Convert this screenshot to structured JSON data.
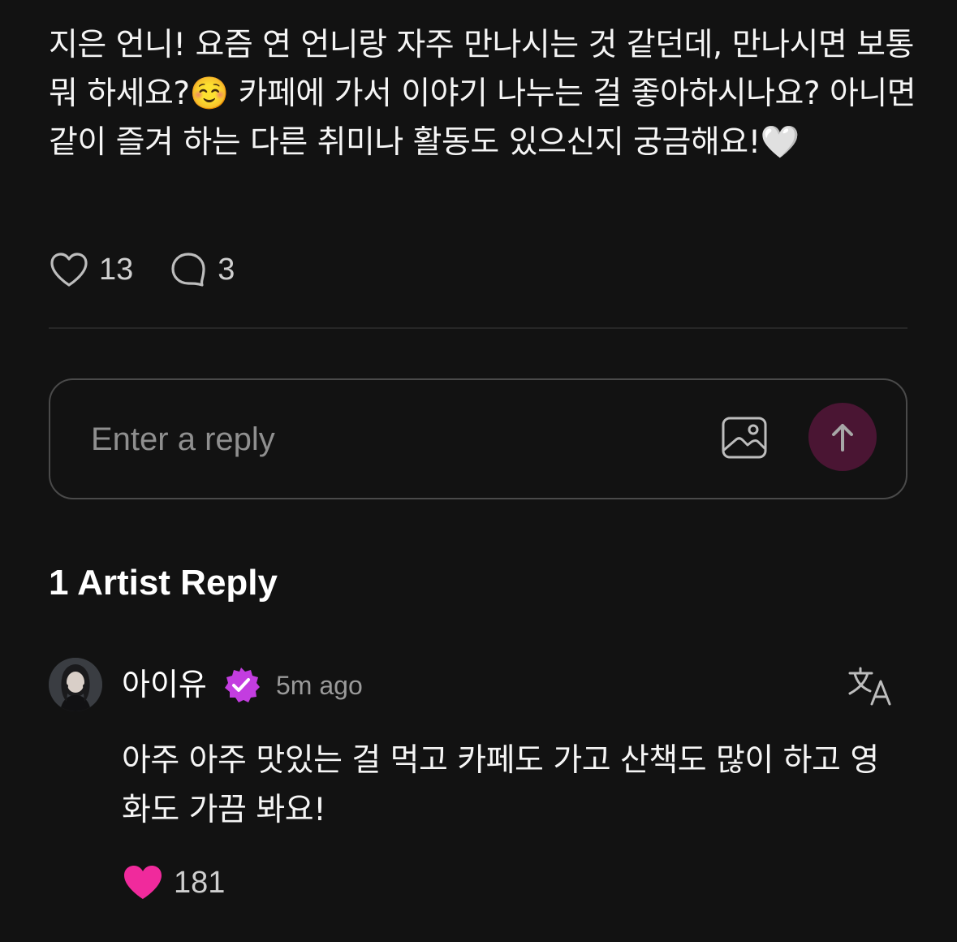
{
  "post": {
    "text": "지은 언니! 요즘 연 언니랑 자주 만나시는 것 같던데, 만나시면 보통 뭐 하세요?☺️ 카페에 가서 이야기 나누는 걸 좋아하시나요? 아니면 같이 즐겨 하는 다른 취미나 활동도 있으신지 궁금해요!🤍",
    "like_count": "13",
    "comment_count": "3"
  },
  "reply_box": {
    "placeholder": "Enter a reply"
  },
  "section": {
    "title": "1 Artist Reply"
  },
  "comment": {
    "author": "아이유",
    "time": "5m ago",
    "text": "아주 아주 맛있는 걸 먹고 카페도 가고 산책도 많이 하고 영화도 가끔 봐요!",
    "like_count": "181"
  },
  "icons": {
    "like": "heart-outline-icon",
    "comment": "speech-bubble-icon",
    "image": "image-icon",
    "send": "arrow-up-icon",
    "verified": "verified-badge-icon",
    "translate": "translate-icon",
    "liked": "heart-filled-icon"
  },
  "colors": {
    "background": "#121212",
    "accent_pink": "#f02a9c",
    "send_button": "#4a1533",
    "verified_badge": "#c33de0"
  }
}
